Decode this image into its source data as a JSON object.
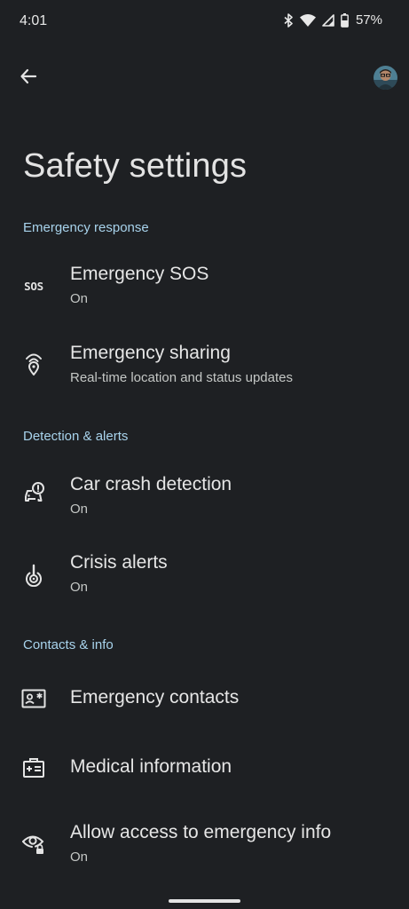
{
  "status_bar": {
    "time": "4:01",
    "battery": "57%",
    "icons": [
      "bluetooth-icon",
      "wifi-icon",
      "cellular-icon",
      "battery-icon"
    ]
  },
  "app_bar": {
    "back_icon": "arrow-back-icon",
    "avatar": "profile-avatar"
  },
  "page": {
    "title": "Safety settings"
  },
  "sections": [
    {
      "header": "Emergency response",
      "items": [
        {
          "icon": "sos-icon",
          "icon_text": "SOS",
          "title": "Emergency SOS",
          "subtitle": "On"
        },
        {
          "icon": "location-broadcast-icon",
          "title": "Emergency sharing",
          "subtitle": "Real-time location and status updates"
        }
      ]
    },
    {
      "header": "Detection & alerts",
      "items": [
        {
          "icon": "car-crash-icon",
          "title": "Car crash detection",
          "subtitle": "On"
        },
        {
          "icon": "crisis-alert-icon",
          "title": "Crisis alerts",
          "subtitle": "On"
        }
      ]
    },
    {
      "header": "Contacts & info",
      "items": [
        {
          "icon": "contact-card-icon",
          "title": "Emergency contacts"
        },
        {
          "icon": "medical-kit-icon",
          "title": "Medical information"
        },
        {
          "icon": "eye-lock-icon",
          "title": "Allow access to emergency info",
          "subtitle": "On"
        }
      ]
    }
  ],
  "colors": {
    "background": "#1e2023",
    "section_header": "#a8d3ec",
    "text_primary": "#e6e6e6",
    "text_secondary": "#c4c7c5"
  }
}
